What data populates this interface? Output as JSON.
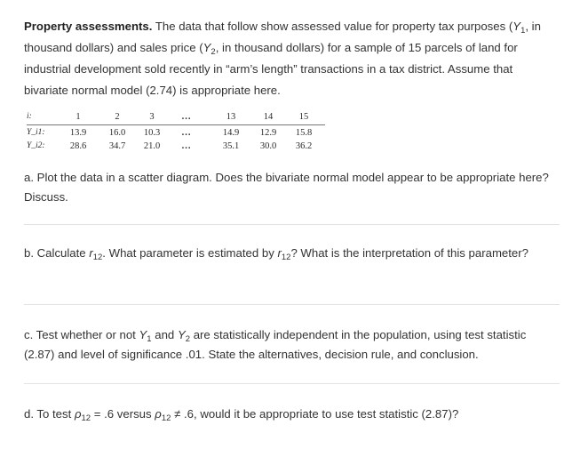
{
  "intro": {
    "title": "Property assessments.",
    "text_1": " The data that follow show assessed value for property tax purposes (",
    "y": "Y",
    "sub_1": "1",
    "text_2": ", in thousand dollars) and sales price (",
    "sub_2": "2",
    "text_3": ", in thousand dollars) for a sample of 15 parcels of land for industrial development sold recently in “arm’s length” transactions in a tax district. Assume that bivariate normal model (2.74) is appropriate here."
  },
  "table": {
    "row_labels": [
      "i:",
      "Y_i1:",
      "Y_i2:"
    ],
    "header": [
      "1",
      "2",
      "3",
      "...",
      "13",
      "14",
      "15"
    ],
    "y1": [
      "13.9",
      "16.0",
      "10.3",
      "...",
      "14.9",
      "12.9",
      "15.8"
    ],
    "y2": [
      "28.6",
      "34.7",
      "21.0",
      "...",
      "35.1",
      "30.0",
      "36.2"
    ]
  },
  "questions": {
    "a": "a. Plot the data in a scatter diagram. Does the bivariate normal model appear to be appropriate here? Discuss.",
    "b_1": "b. Calculate ",
    "r": "r",
    "sub_12": "12",
    "b_2": ". What parameter is estimated by ",
    "b_3": "? What is the interpretation of this parameter?",
    "c_1": "c. Test whether or not ",
    "c_and": " and ",
    "c_2": " are statistically independent in the population, using test statistic (2.87) and level of significance .01. State the alternatives, decision rule, and conclusion.",
    "d_1": "d. To test ",
    "rho": "ρ",
    "d_2": " = .6 versus ",
    "d_3": " ≠ .6, would it be appropriate to use test statistic (2.87)?"
  }
}
